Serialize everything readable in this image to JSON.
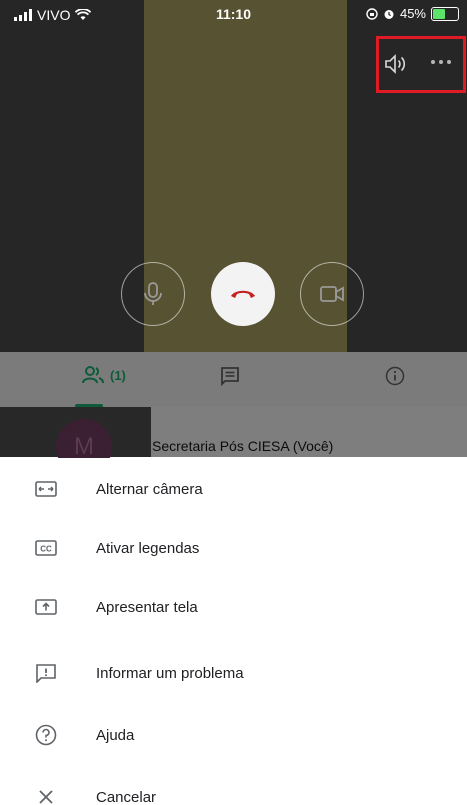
{
  "status_bar": {
    "carrier": "VIVO",
    "time": "11:10",
    "battery": "45%"
  },
  "call_controls": {
    "mic": "mic-off",
    "end": "end-call",
    "camera": "camera-off"
  },
  "tabs": {
    "people_count": "(1)"
  },
  "participant": {
    "initial": "M",
    "name": "Secretaria Pós CIESA (Você)"
  },
  "menu": {
    "items": [
      {
        "label": "Alternar câmera"
      },
      {
        "label": "Ativar legendas"
      },
      {
        "label": "Apresentar tela"
      },
      {
        "label": "Informar um problema"
      },
      {
        "label": "Ajuda"
      },
      {
        "label": "Cancelar"
      }
    ]
  },
  "colors": {
    "highlight": "#e01b24",
    "accent": "#0e5b3a",
    "end_call": "#c5221f"
  }
}
